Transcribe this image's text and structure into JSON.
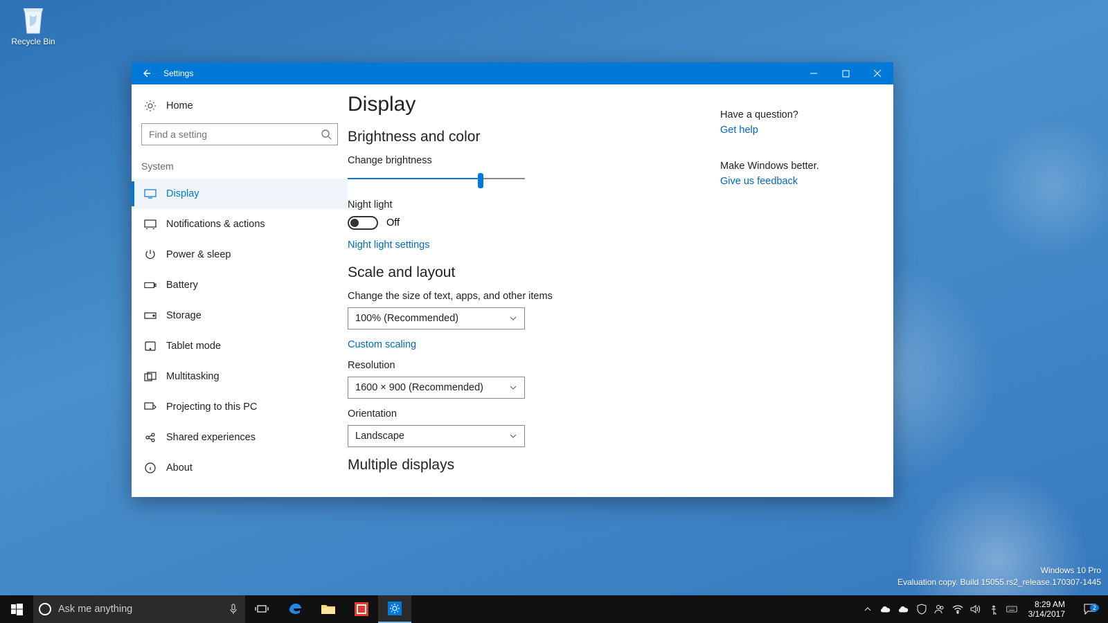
{
  "desktop": {
    "recycle_bin": "Recycle Bin"
  },
  "window": {
    "title": "Settings",
    "sidebar": {
      "home": "Home",
      "search_placeholder": "Find a setting",
      "category": "System",
      "items": [
        {
          "label": "Display",
          "icon": "display-icon",
          "active": true
        },
        {
          "label": "Notifications & actions",
          "icon": "notifications-icon"
        },
        {
          "label": "Power & sleep",
          "icon": "power-icon"
        },
        {
          "label": "Battery",
          "icon": "battery-icon"
        },
        {
          "label": "Storage",
          "icon": "storage-icon"
        },
        {
          "label": "Tablet mode",
          "icon": "tablet-icon"
        },
        {
          "label": "Multitasking",
          "icon": "multitasking-icon"
        },
        {
          "label": "Projecting to this PC",
          "icon": "projecting-icon"
        },
        {
          "label": "Shared experiences",
          "icon": "shared-icon"
        },
        {
          "label": "About",
          "icon": "about-icon"
        }
      ]
    },
    "main": {
      "title": "Display",
      "section1": {
        "heading": "Brightness and color",
        "brightness_label": "Change brightness",
        "brightness_pct": 75,
        "night_light_label": "Night light",
        "night_light_state": "Off",
        "night_light_link": "Night light settings"
      },
      "section2": {
        "heading": "Scale and layout",
        "scale_label": "Change the size of text, apps, and other items",
        "scale_value": "100% (Recommended)",
        "custom_scaling": "Custom scaling",
        "resolution_label": "Resolution",
        "resolution_value": "1600 × 900 (Recommended)",
        "orientation_label": "Orientation",
        "orientation_value": "Landscape"
      },
      "section3": {
        "heading": "Multiple displays"
      }
    },
    "right": {
      "question": "Have a question?",
      "help_link": "Get help",
      "feedback_heading": "Make Windows better.",
      "feedback_link": "Give us feedback"
    }
  },
  "watermark": {
    "line1": "Windows 10 Pro",
    "line2": "Evaluation copy. Build 15055.rs2_release.170307-1445"
  },
  "taskbar": {
    "search_placeholder": "Ask me anything",
    "time": "8:29 AM",
    "date": "3/14/2017",
    "notif_count": "2"
  }
}
